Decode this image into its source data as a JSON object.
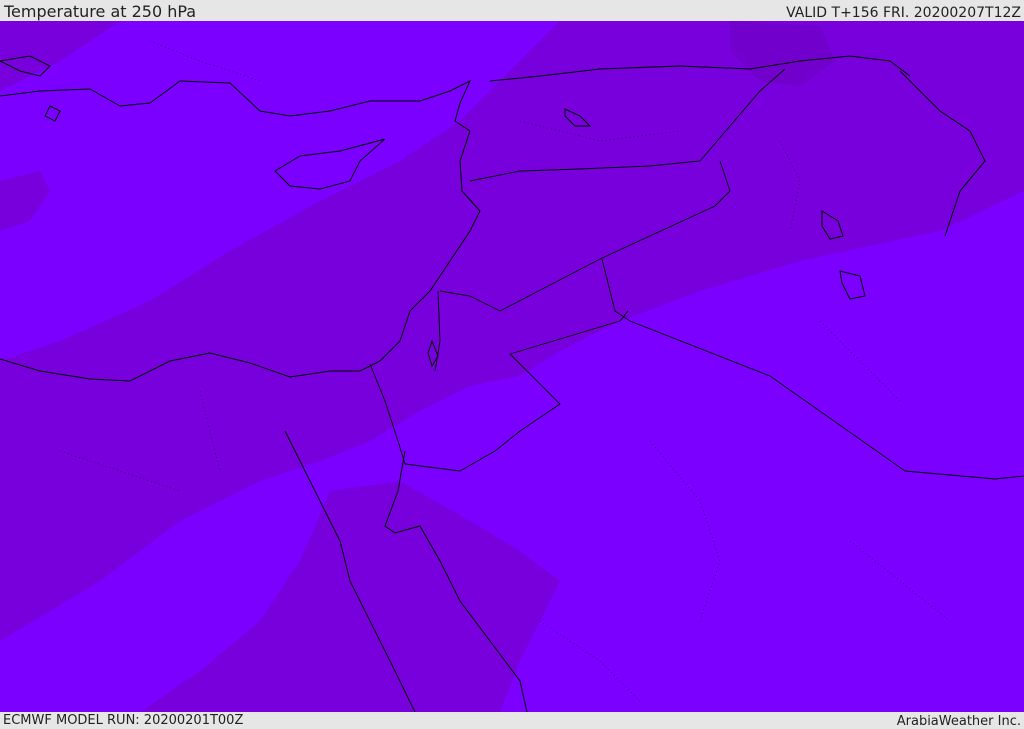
{
  "header": {
    "title": "Temperature at 250 hPa",
    "valid_time": "VALID T+156 FRI. 20200207T12Z"
  },
  "footer": {
    "model_run": "ECMWF MODEL RUN: 20200201T00Z",
    "credit": "ArabiaWeather Inc."
  },
  "map": {
    "field_colors": {
      "warm_band": "#7700dd",
      "cool_field": "#7b00ff",
      "slightly_warmer_patch": "#7100cc"
    },
    "coastline_color": "#000000",
    "border_style": "solid",
    "internal_border_style": "dotted"
  }
}
